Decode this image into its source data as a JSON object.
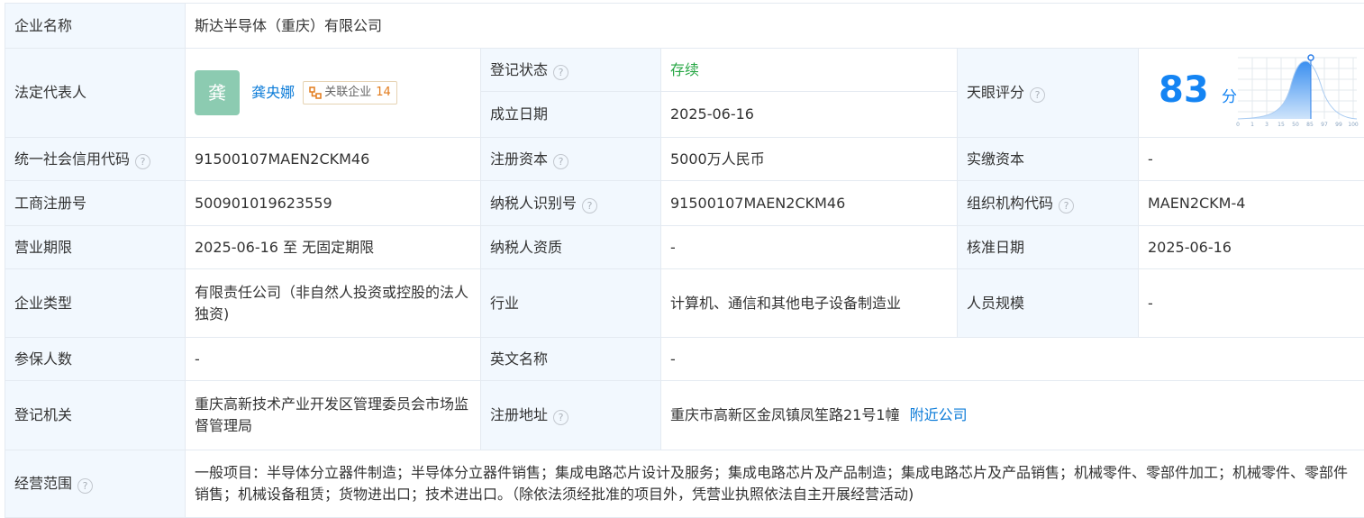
{
  "company": {
    "label": "企业名称",
    "value": "斯达半导体（重庆）有限公司"
  },
  "legal_rep": {
    "label": "法定代表人",
    "avatar_char": "龚",
    "name": "龚央娜",
    "tag_label": "关联企业",
    "tag_count": "14",
    "tag_icon": "network-icon"
  },
  "reg_status": {
    "label": "登记状态",
    "value": "存续",
    "color": "#28a745"
  },
  "found_date": {
    "label": "成立日期",
    "value": "2025-06-16"
  },
  "tianyan": {
    "label": "天眼评分",
    "score": "83",
    "unit": "分",
    "axis_ticks": [
      "0",
      "1",
      "3",
      "15",
      "50",
      "85",
      "97",
      "99",
      "100"
    ],
    "color": "#1484f3"
  },
  "credit_code": {
    "label": "统一社会信用代码",
    "value": "91500107MAEN2CKM46"
  },
  "reg_capital": {
    "label": "注册资本",
    "value": "5000万人民币"
  },
  "paid_capital": {
    "label": "实缴资本",
    "value": "-"
  },
  "biz_reg_no": {
    "label": "工商注册号",
    "value": "500901019623559"
  },
  "taxpayer_id": {
    "label": "纳税人识别号",
    "value": "91500107MAEN2CKM46"
  },
  "org_code": {
    "label": "组织机构代码",
    "value": "MAEN2CKM-4"
  },
  "biz_term": {
    "label": "营业期限",
    "value": "2025-06-16 至 无固定期限"
  },
  "taxpayer_qual": {
    "label": "纳税人资质",
    "value": "-"
  },
  "approve_date": {
    "label": "核准日期",
    "value": "2025-06-16"
  },
  "company_type": {
    "label": "企业类型",
    "value": "有限责任公司（非自然人投资或控股的法人独资)"
  },
  "industry": {
    "label": "行业",
    "value": "计算机、通信和其他电子设备制造业"
  },
  "staff_size": {
    "label": "人员规模",
    "value": "-"
  },
  "insured": {
    "label": "参保人数",
    "value": "-"
  },
  "english_name": {
    "label": "英文名称",
    "value": "-"
  },
  "reg_authority": {
    "label": "登记机关",
    "value": "重庆高新技术产业开发区管理委员会市场监督管理局"
  },
  "reg_address": {
    "label": "注册地址",
    "value": "重庆市高新区金凤镇凤笙路21号1幢",
    "link": "附近公司"
  },
  "biz_scope": {
    "label": "经营范围",
    "value": "一般项目：半导体分立器件制造；半导体分立器件销售；集成电路芯片设计及服务；集成电路芯片及产品制造；集成电路芯片及产品销售；机械零件、零部件加工；机械零件、零部件销售；机械设备租赁；货物进出口；技术进出口。（除依法须经批准的项目外，凭营业执照依法自主开展经营活动)"
  },
  "help_icon": "question-circle-icon"
}
